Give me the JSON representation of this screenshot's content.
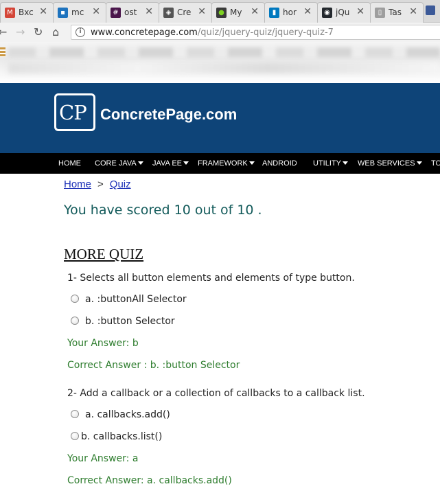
{
  "browser": {
    "tabs": [
      {
        "label": "Bxc",
        "icon": "gmail-icon",
        "icon_glyph": "M",
        "icon_color": "#d44638"
      },
      {
        "label": "mc",
        "icon": "monitor-icon",
        "icon_glyph": "▪",
        "icon_color": "#1e73be"
      },
      {
        "label": "ost",
        "icon": "slack-icon",
        "icon_glyph": "#",
        "icon_color": "#4a154b"
      },
      {
        "label": "Cre",
        "icon": "codepen-icon",
        "icon_glyph": "◈",
        "icon_color": "#555555"
      },
      {
        "label": "My",
        "icon": "app-green-icon",
        "icon_glyph": "●",
        "icon_color": "#3a3a3a"
      },
      {
        "label": "hor",
        "icon": "trello-icon",
        "icon_glyph": "▮",
        "icon_color": "#0079bf"
      },
      {
        "label": "jQu",
        "icon": "github-icon",
        "icon_glyph": "◉",
        "icon_color": "#24292e"
      },
      {
        "label": "Tas",
        "icon": "page-icon",
        "icon_glyph": "▯",
        "icon_color": "#9e9e9e"
      }
    ],
    "tab_close_glyph": "✕",
    "url_host": "www.concretepage.com",
    "url_path": "/quiz/jquery-quiz/jquery-quiz-7"
  },
  "site": {
    "logo_text": "CP",
    "name": "ConcretePage.com",
    "menu": [
      {
        "label": "HOME",
        "dropdown": false
      },
      {
        "label": "CORE JAVA",
        "dropdown": true
      },
      {
        "label": "JAVA EE",
        "dropdown": true
      },
      {
        "label": "FRAMEWORK",
        "dropdown": true
      },
      {
        "label": "ANDROID",
        "dropdown": false
      },
      {
        "label": "UTILITY",
        "dropdown": true
      },
      {
        "label": "WEB SERVICES",
        "dropdown": true
      },
      {
        "label": "TO",
        "dropdown": false
      }
    ]
  },
  "breadcrumb": {
    "home": "Home",
    "separator": ">",
    "current": "Quiz"
  },
  "score_text": "You have scored 10 out of 10 .",
  "more_quiz_heading": "MORE QUIZ",
  "questions": [
    {
      "text": "1- Selects all button elements and elements of type button.",
      "options": [
        "a. :buttonAll Selector",
        "b. :button Selector"
      ],
      "your_answer": "Your Answer: b",
      "correct_answer": "Correct Answer : b. :button Selector"
    },
    {
      "text": "2- Add a callback or a collection of callbacks to a callback list.",
      "options": [
        "a. callbacks.add()",
        "b. callbacks.list()"
      ],
      "your_answer": "Your Answer: a",
      "correct_answer": "Correct Answer: a. callbacks.add()"
    }
  ],
  "colors": {
    "header_bg": "#0e4478",
    "score": "#125a5a",
    "answer_green": "#2e7d2e",
    "link": "#1a2fb6"
  }
}
